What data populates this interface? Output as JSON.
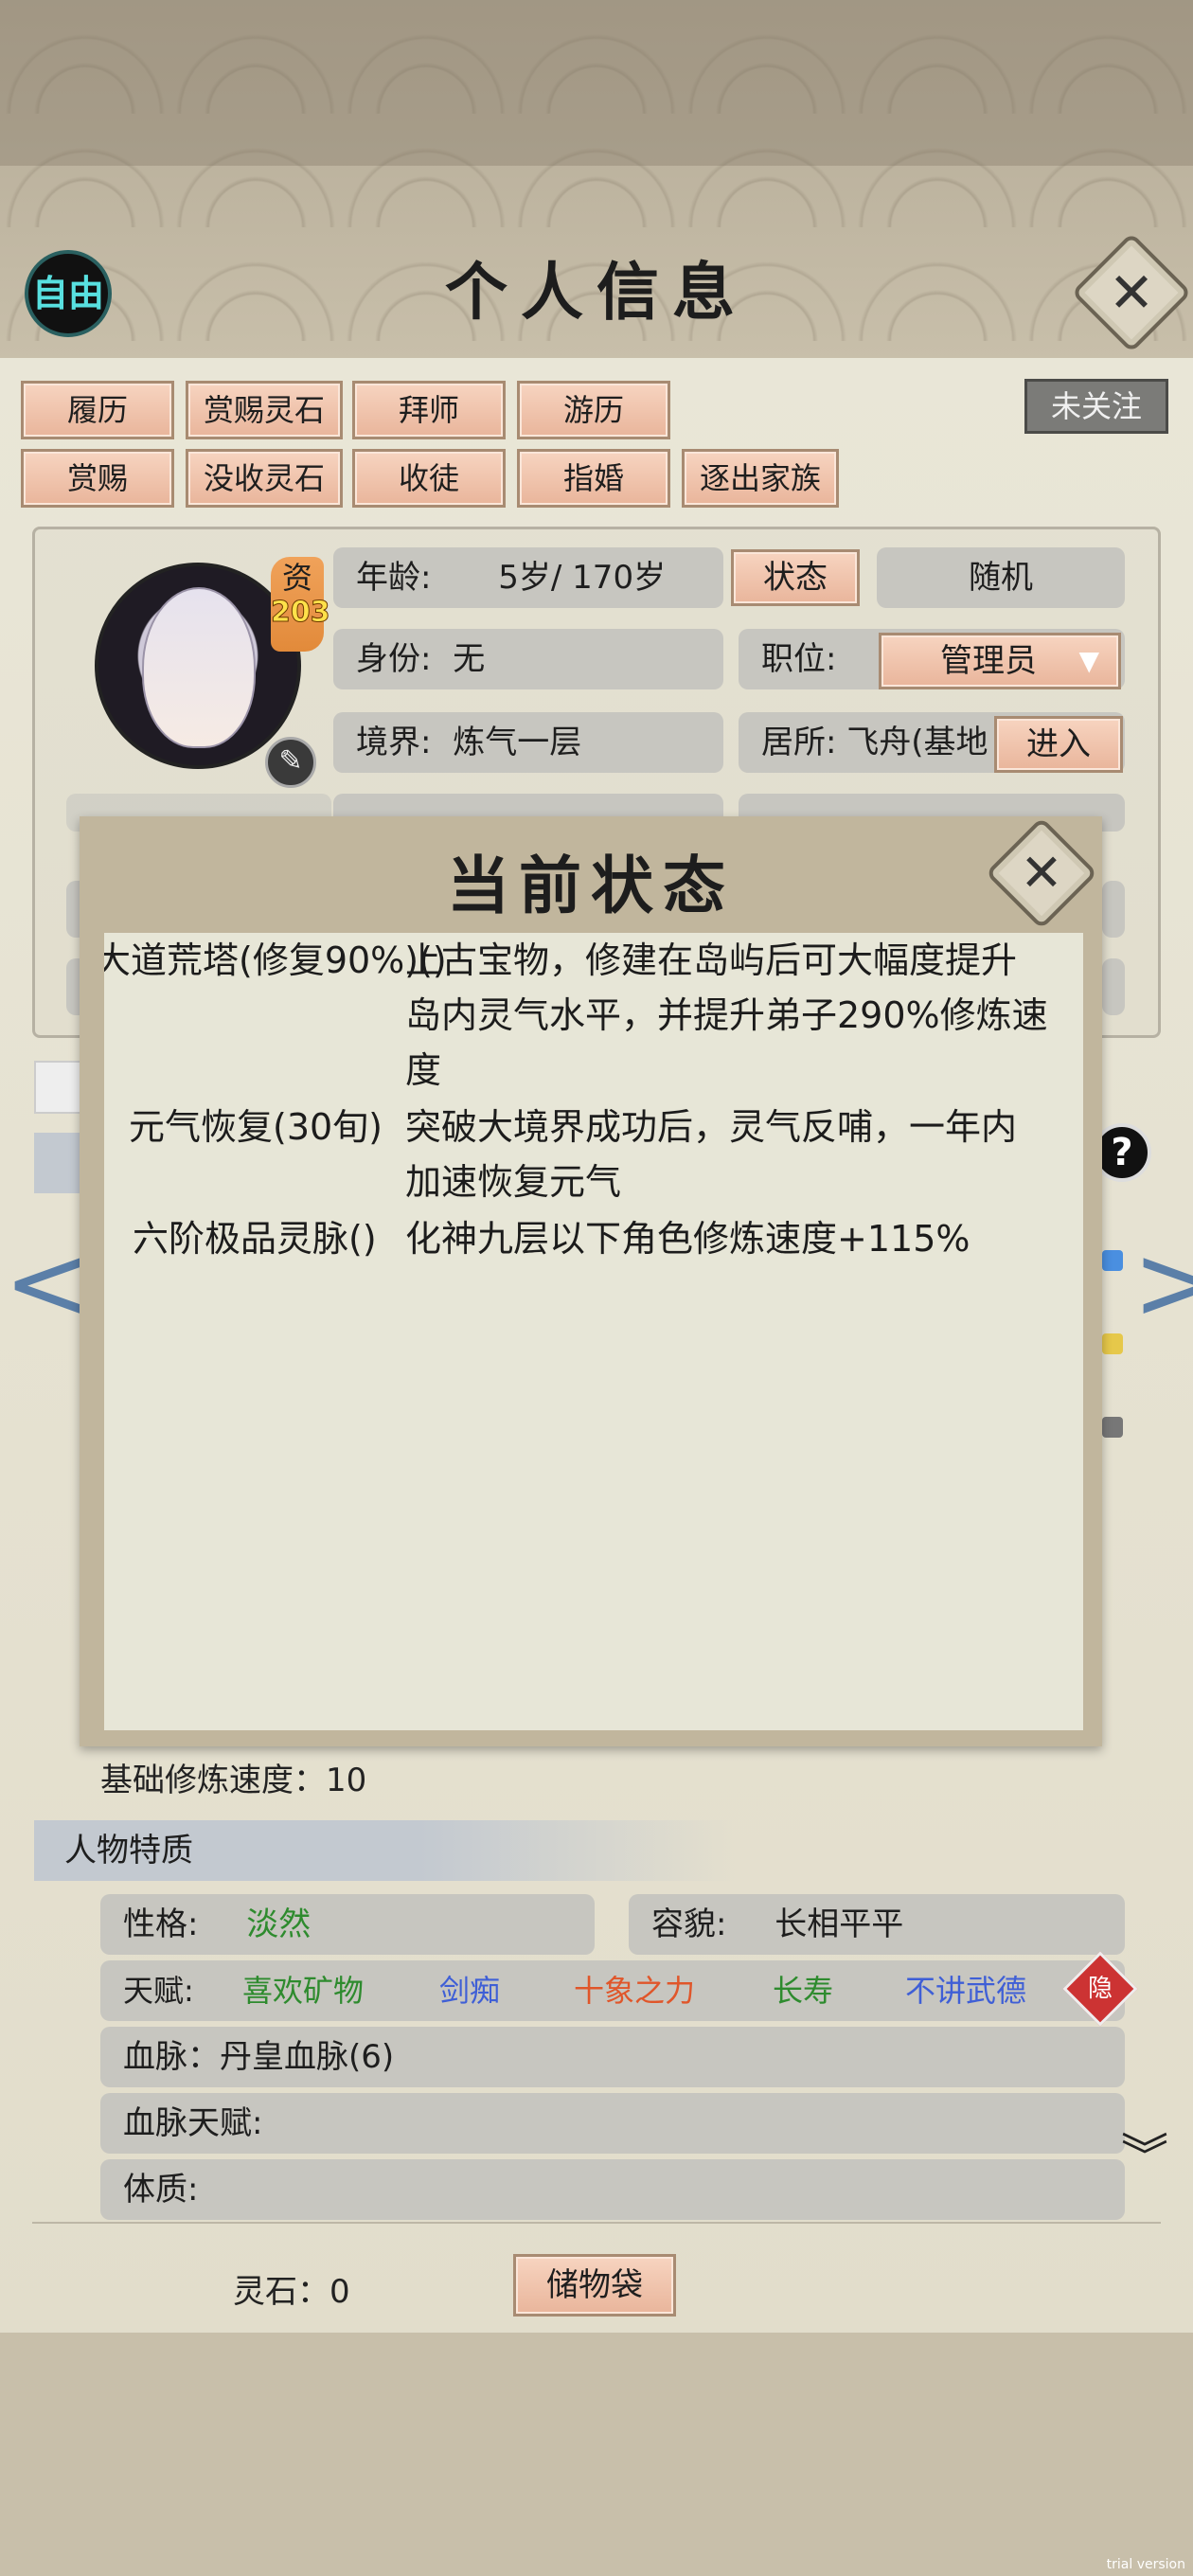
{
  "header": {
    "title": "个人信息",
    "free_label": "自由",
    "close_icon": "✕",
    "follow_label": "未关注"
  },
  "action_buttons": {
    "row1": [
      "履历",
      "赏赐灵石",
      "拜师",
      "游历"
    ],
    "row2": [
      "赏赐",
      "没收灵石",
      "收徒",
      "指婚",
      "逐出家族"
    ]
  },
  "profile": {
    "zi_label": "资",
    "zi_value": "203",
    "age_label": "年龄:",
    "age_value": "5岁/ 170岁",
    "status_button": "状态",
    "random_button": "随机",
    "identity_label": "身份:",
    "identity_value": "无",
    "position_label": "职位:",
    "position_value": "管理员",
    "realm_label": "境界:",
    "realm_value": "炼气一层",
    "residence_label": "居所:",
    "residence_value": "飞舟(基地",
    "enter_button": "进入"
  },
  "modal": {
    "title": "当前状态",
    "close_icon": "✕",
    "statuses": [
      {
        "name": "大道荒塔(修复90%)()",
        "desc": "上古宝物，修建在岛屿后可大幅度提升岛内灵气水平，并提升弟子290%修炼速度"
      },
      {
        "name": "元气恢复(30旬)",
        "desc": "突破大境界成功后，灵气反哺，一年内加速恢复元气"
      },
      {
        "name": "六阶极品灵脉()",
        "desc": "化神九层以下角色修炼速度+115%"
      }
    ]
  },
  "cultivation": {
    "base_speed": "基础修炼速度：10"
  },
  "traits": {
    "section_title": "人物特质",
    "personality_label": "性格:",
    "personality_value": "淡然",
    "appearance_label": "容貌:",
    "appearance_value": "长相平平",
    "talent_label": "天赋:",
    "talents": [
      "喜欢矿物",
      "剑痴",
      "十象之力",
      "长寿",
      "不讲武德"
    ],
    "talent_colors": [
      "#2e8b2e",
      "#3f5fd6",
      "#e0562a",
      "#2e8b2e",
      "#3f5fd6"
    ],
    "hide_label": "隐",
    "bloodline": "血脉：丹皇血脉(6)",
    "bloodline_talent": "血脉天赋:",
    "physique": "体质:"
  },
  "footer": {
    "spirit_stone": "灵石：0",
    "storage_button": "储物袋"
  },
  "watermark": "trial version"
}
